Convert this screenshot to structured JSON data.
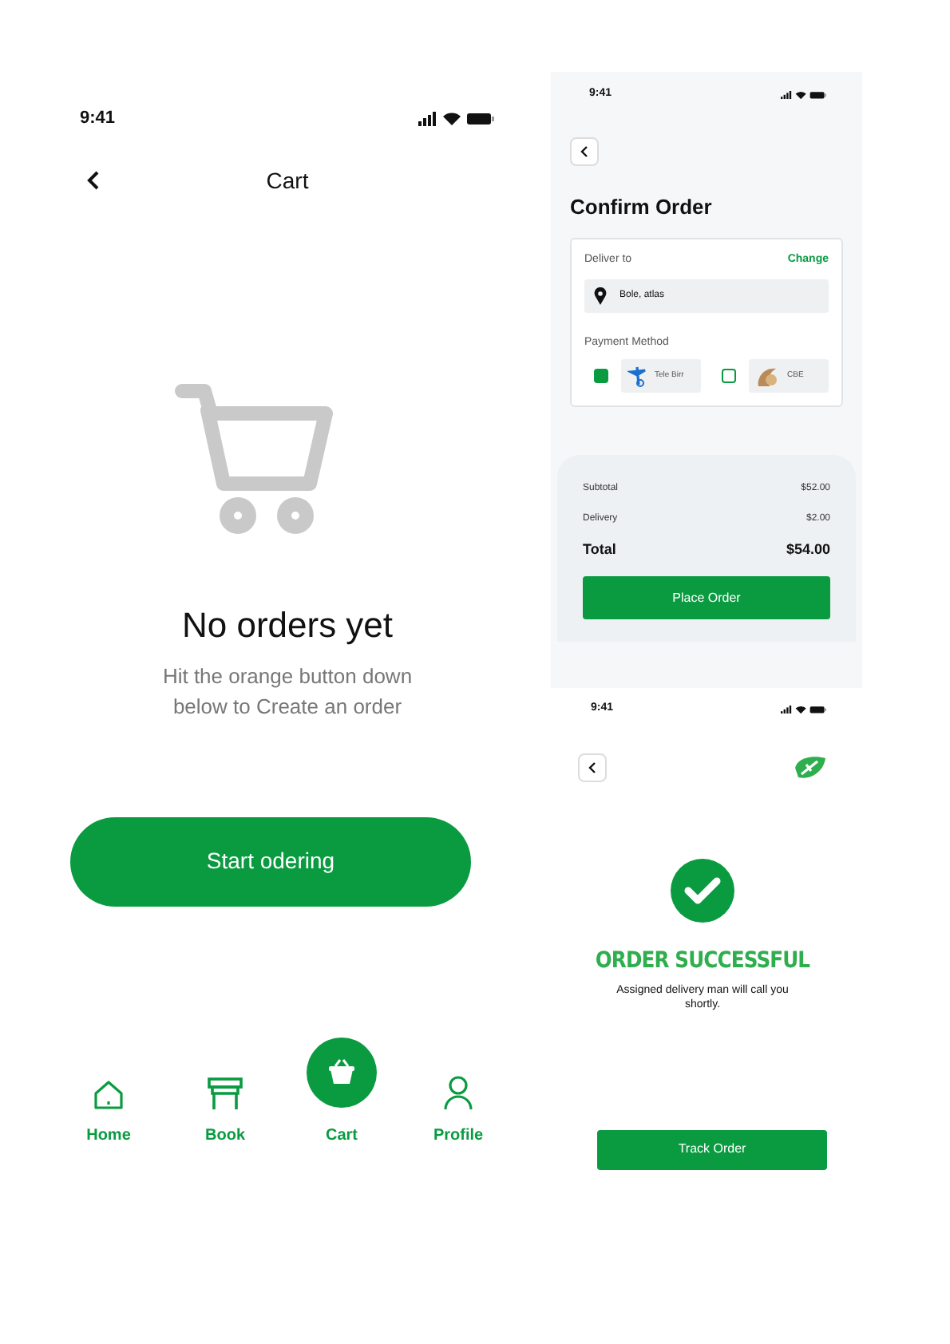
{
  "cart_screen": {
    "status_time": "9:41",
    "title": "Cart",
    "empty_title": "No orders yet",
    "empty_message": "Hit the orange button down below to Create an order",
    "start_button": "Start odering",
    "nav_items": [
      {
        "label": "Home",
        "kind": "home",
        "selected": false
      },
      {
        "label": "Book",
        "kind": "book",
        "selected": false
      },
      {
        "label": "Cart",
        "kind": "cart",
        "selected": true
      },
      {
        "label": "Profile",
        "kind": "profile",
        "selected": false
      }
    ]
  },
  "confirm_screen": {
    "status_time": "9:41",
    "title": "Confirm Order",
    "deliver_label": "Deliver to",
    "change_link": "Change",
    "address": "Bole, atlas",
    "payment_label": "Payment Method",
    "payment_methods": [
      {
        "label": "Tele Birr",
        "kind": "telebirr",
        "selected": true
      },
      {
        "label": "CBE",
        "kind": "cbe",
        "selected": false
      }
    ],
    "summary": [
      {
        "label": "Subtotal",
        "value": "$52.00",
        "kind": "line"
      },
      {
        "label": "Delivery",
        "value": "$2.00",
        "kind": "line"
      },
      {
        "label": "Total",
        "value": "$54.00",
        "kind": "total"
      }
    ],
    "place_button": "Place Order"
  },
  "success_screen": {
    "status_time": "9:41",
    "title": "ORDER SUCCESSFUL",
    "message": "Assigned delivery man will call you shortly.",
    "track_button": "Track Order"
  }
}
